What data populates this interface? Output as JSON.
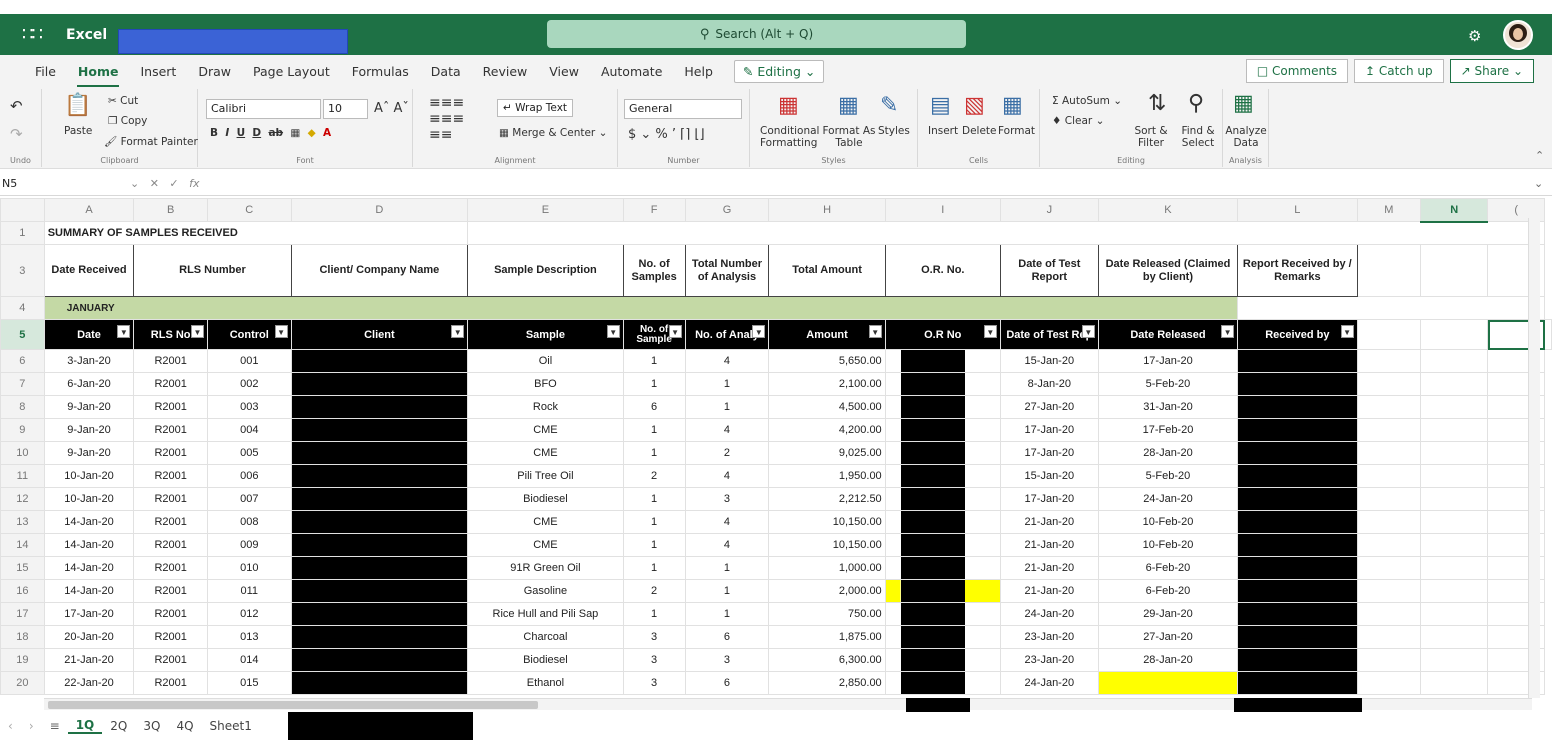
{
  "titlebar": {
    "app_name": "Excel",
    "search_placeholder": "Search (Alt + Q)"
  },
  "menu": {
    "tabs": [
      "File",
      "Home",
      "Insert",
      "Draw",
      "Page Layout",
      "Formulas",
      "Data",
      "Review",
      "View",
      "Automate",
      "Help"
    ],
    "active_tab": "Home",
    "editing_label": "Editing",
    "comments_label": "Comments",
    "catchup_label": "Catch up",
    "share_label": "Share"
  },
  "ribbon": {
    "undo_label": "Undo",
    "paste_label": "Paste",
    "cut_label": "Cut",
    "copy_label": "Copy",
    "format_painter_label": "Format Painter",
    "clipboard_label": "Clipboard",
    "font_name": "Calibri",
    "font_size": "10",
    "font_label": "Font",
    "wrap_text_label": "Wrap Text",
    "merge_label": "Merge & Center",
    "alignment_label": "Alignment",
    "number_format": "General",
    "number_label": "Number",
    "conditional_label": "Conditional Formatting",
    "format_table_label": "Format As Table",
    "styles_btn_label": "Styles",
    "styles_label": "Styles",
    "insert_label": "Insert",
    "delete_label": "Delete",
    "format_label": "Format",
    "cells_label": "Cells",
    "autosum_label": "AutoSum",
    "clear_label": "Clear",
    "sort_label": "Sort & Filter",
    "find_label": "Find & Select",
    "editing_group_label": "Editing",
    "analyze_label": "Analyze Data",
    "analysis_label": "Analysis"
  },
  "formula": {
    "name_box": "N5",
    "fx": "fx"
  },
  "columns": [
    "A",
    "B",
    "C",
    "D",
    "E",
    "F",
    "G",
    "H",
    "I",
    "J",
    "K",
    "L",
    "M",
    "N",
    "("
  ],
  "sheet": {
    "title": "SUMMARY OF SAMPLES RECEIVED",
    "headers": [
      "Date Received",
      "RLS Number",
      "Client/ Company Name",
      "Sample Description",
      "No. of Samples",
      "Total Number of Analysis",
      "Total Amount",
      "O.R. No.",
      "Date of Test Report",
      "Date Released (Claimed by Client)",
      "Report Received by / Remarks"
    ],
    "month": "JANUARY",
    "table_headers": [
      "Date",
      "RLS No",
      "Control",
      "Client",
      "Sample",
      "No. of Sample",
      "No. of Analy",
      "Amount",
      "O.R No",
      "Date of Test Rep",
      "Date Released",
      "Received by"
    ],
    "rows": [
      {
        "n": "6",
        "date": "3-Jan-20",
        "rls": "R2001",
        "ctrl": "001",
        "sample": "Oil",
        "ns": "1",
        "na": "4",
        "amt": "5,650.00",
        "dtr": "15-Jan-20",
        "dr": "17-Jan-20"
      },
      {
        "n": "7",
        "date": "6-Jan-20",
        "rls": "R2001",
        "ctrl": "002",
        "sample": "BFO",
        "ns": "1",
        "na": "1",
        "amt": "2,100.00",
        "dtr": "8-Jan-20",
        "dr": "5-Feb-20"
      },
      {
        "n": "8",
        "date": "9-Jan-20",
        "rls": "R2001",
        "ctrl": "003",
        "sample": "Rock",
        "ns": "6",
        "na": "1",
        "amt": "4,500.00",
        "dtr": "27-Jan-20",
        "dr": "31-Jan-20"
      },
      {
        "n": "9",
        "date": "9-Jan-20",
        "rls": "R2001",
        "ctrl": "004",
        "sample": "CME",
        "ns": "1",
        "na": "4",
        "amt": "4,200.00",
        "dtr": "17-Jan-20",
        "dr": "17-Feb-20"
      },
      {
        "n": "10",
        "date": "9-Jan-20",
        "rls": "R2001",
        "ctrl": "005",
        "sample": "CME",
        "ns": "1",
        "na": "2",
        "amt": "9,025.00",
        "dtr": "17-Jan-20",
        "dr": "28-Jan-20"
      },
      {
        "n": "11",
        "date": "10-Jan-20",
        "rls": "R2001",
        "ctrl": "006",
        "sample": "Pili Tree Oil",
        "ns": "2",
        "na": "4",
        "amt": "1,950.00",
        "dtr": "15-Jan-20",
        "dr": "5-Feb-20"
      },
      {
        "n": "12",
        "date": "10-Jan-20",
        "rls": "R2001",
        "ctrl": "007",
        "sample": "Biodiesel",
        "ns": "1",
        "na": "3",
        "amt": "2,212.50",
        "dtr": "17-Jan-20",
        "dr": "24-Jan-20"
      },
      {
        "n": "13",
        "date": "14-Jan-20",
        "rls": "R2001",
        "ctrl": "008",
        "sample": "CME",
        "ns": "1",
        "na": "4",
        "amt": "10,150.00",
        "dtr": "21-Jan-20",
        "dr": "10-Feb-20"
      },
      {
        "n": "14",
        "date": "14-Jan-20",
        "rls": "R2001",
        "ctrl": "009",
        "sample": "CME",
        "ns": "1",
        "na": "4",
        "amt": "10,150.00",
        "dtr": "21-Jan-20",
        "dr": "10-Feb-20"
      },
      {
        "n": "15",
        "date": "14-Jan-20",
        "rls": "R2001",
        "ctrl": "010",
        "sample": "91R Green Oil",
        "ns": "1",
        "na": "1",
        "amt": "1,000.00",
        "dtr": "21-Jan-20",
        "dr": "6-Feb-20"
      },
      {
        "n": "16",
        "date": "14-Jan-20",
        "rls": "R2001",
        "ctrl": "011",
        "sample": "Gasoline",
        "ns": "2",
        "na": "1",
        "amt": "2,000.00",
        "dtr": "21-Jan-20",
        "dr": "6-Feb-20",
        "yellow": true
      },
      {
        "n": "17",
        "date": "17-Jan-20",
        "rls": "R2001",
        "ctrl": "012",
        "sample": "Rice Hull and Pili Sap",
        "ns": "1",
        "na": "1",
        "amt": "750.00",
        "dtr": "24-Jan-20",
        "dr": "29-Jan-20"
      },
      {
        "n": "18",
        "date": "20-Jan-20",
        "rls": "R2001",
        "ctrl": "013",
        "sample": "Charcoal",
        "ns": "3",
        "na": "6",
        "amt": "1,875.00",
        "dtr": "23-Jan-20",
        "dr": "27-Jan-20"
      },
      {
        "n": "19",
        "date": "21-Jan-20",
        "rls": "R2001",
        "ctrl": "014",
        "sample": "Biodiesel",
        "ns": "3",
        "na": "3",
        "amt": "6,300.00",
        "dtr": "23-Jan-20",
        "dr": "28-Jan-20"
      },
      {
        "n": "20",
        "date": "22-Jan-20",
        "rls": "R2001",
        "ctrl": "015",
        "sample": "Ethanol",
        "ns": "3",
        "na": "6",
        "amt": "2,850.00",
        "dtr": "24-Jan-20",
        "dr": "",
        "dr_yellow": true
      }
    ]
  },
  "sheet_tabs": {
    "tabs": [
      "1Q",
      "2Q",
      "3Q",
      "4Q",
      "Sheet1"
    ],
    "active": "1Q"
  },
  "colors": {
    "excel_green": "#1e7145",
    "month_band": "#c4d9a5",
    "highlight": "#ffff00"
  }
}
